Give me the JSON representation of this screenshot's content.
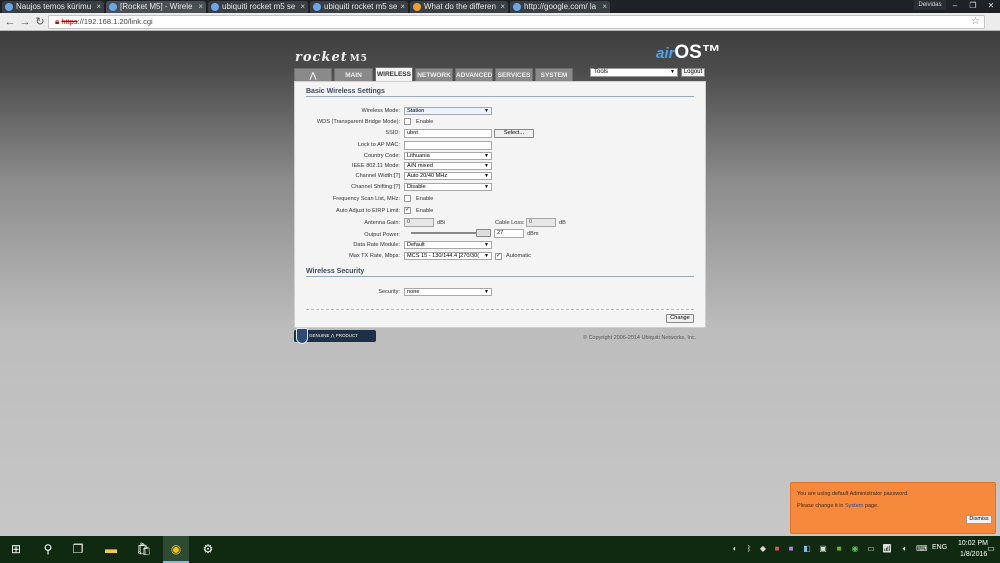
{
  "browser": {
    "tabs": [
      {
        "title": "Naujos temos kūrimu",
        "active": false
      },
      {
        "title": "[Rocket M5] - Wirele",
        "active": true
      },
      {
        "title": "ubiquiti rocket m5 se",
        "active": false
      },
      {
        "title": "ubiquiti rocket m5 se",
        "active": false
      },
      {
        "title": "What do the differen",
        "active": false
      },
      {
        "title": "http://google.com/ la",
        "active": false
      }
    ],
    "tab_close": "×",
    "user_chip": "Deividas",
    "url_scheme": "https",
    "url_rest": "://192.168.1.20/link.cgi"
  },
  "airos": {
    "brand": "rocket",
    "model": "M5",
    "logo_prefix": "air",
    "logo_suffix": "OS™",
    "nav_tabs": [
      "MAIN",
      "WIRELESS",
      "NETWORK",
      "ADVANCED",
      "SERVICES",
      "SYSTEM"
    ],
    "tools_select": "Tools",
    "logout": "Logout",
    "basic_title": "Basic Wireless Settings",
    "labels": {
      "wireless_mode": "Wireless Mode:",
      "wds": "WDS (Transparent Bridge Mode):",
      "ssid": "SSID:",
      "lock_ap": "Lock to AP MAC:",
      "country": "Country Code:",
      "ieee": "IEEE 802.11 Mode:",
      "channel_width": "Channel Width:[?]",
      "channel_shifting": "Channel Shifting:[?]",
      "freq_scan": "Frequency Scan List, MHz:",
      "auto_adjust": "Auto Adjust to EIRP Limit:",
      "antenna_gain": "Antenna Gain:",
      "cable_loss": "Cable Loss:",
      "output_power": "Output Power:",
      "data_rate": "Data Rate Module:",
      "max_tx": "Max TX Rate, Mbps:",
      "security": "Security:"
    },
    "values": {
      "wireless_mode": "Station",
      "wds_enable": "Enable",
      "ssid": "ubnt",
      "select_btn": "Select...",
      "lock_ap": "",
      "country": "Lithuania",
      "ieee": "A/N mixed",
      "channel_width": "Auto 20/40 MHz",
      "channel_shifting": "Disable",
      "freq_enable": "Enable",
      "auto_enable": "Enable",
      "antenna_gain": "0",
      "antenna_unit": "dBi",
      "cable_loss": "0",
      "cable_unit": "dB",
      "output_power": "27",
      "output_unit": "dBm",
      "data_rate": "Default",
      "max_tx": "MCS 15 - 130/144.4 [270/30(",
      "automatic": "Automatic",
      "security": "none"
    },
    "security_title": "Wireless Security",
    "change_btn": "Change",
    "genuine": "GENUINE ⋀ PRODUCT",
    "copyright": "© Copyright 2006-2014 Ubiquiti Networks, Inc."
  },
  "toast": {
    "line1": "You are using default Administrator password.",
    "line2_pre": "Please change it in ",
    "line2_link": "System",
    "line2_post": " page.",
    "dismiss": "Dismiss"
  },
  "taskbar": {
    "lang": "ENG",
    "time": "10:02 PM",
    "date": "1/8/2016"
  },
  "colors": {
    "accent": "#4aa3f0",
    "toast": "#f7893d",
    "taskbar": "#0f2a10"
  }
}
